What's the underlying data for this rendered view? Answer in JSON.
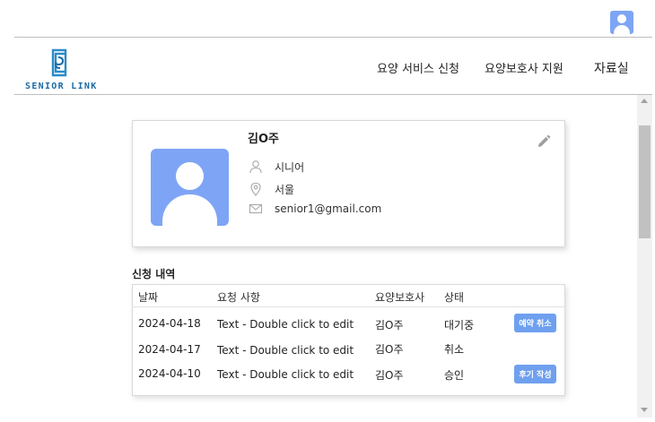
{
  "header": {
    "logo_text": "SENIOR LINK",
    "nav": [
      "요양 서비스 신청",
      "요양보호사 지원",
      "자료실"
    ]
  },
  "profile": {
    "name": "김O주",
    "role": "시니어",
    "location": "서울",
    "email": "senior1@gmail.com"
  },
  "history": {
    "title": "신청 내역",
    "columns": [
      "날짜",
      "요청 사항",
      "요양보호사",
      "상태"
    ],
    "rows": [
      {
        "date": "2024-04-18",
        "request": "Text - Double click to edit",
        "caregiver": "김O주",
        "status": "대기중",
        "action": "예약 취소"
      },
      {
        "date": "2024-04-17",
        "request": "Text - Double click to edit",
        "caregiver": "김O주",
        "status": "취소",
        "action": ""
      },
      {
        "date": "2024-04-10",
        "request": "Text - Double click to edit",
        "caregiver": "김O주",
        "status": "승인",
        "action": "후기 작성"
      }
    ]
  },
  "colors": {
    "accent": "#6fa0ef",
    "avatar": "#7ea5f5",
    "logo": "#1b6aa3"
  },
  "icons": {
    "top_right": "user-avatar-icon",
    "edit": "pencil-icon",
    "role": "person-icon",
    "location": "map-pin-icon",
    "email": "envelope-icon"
  }
}
